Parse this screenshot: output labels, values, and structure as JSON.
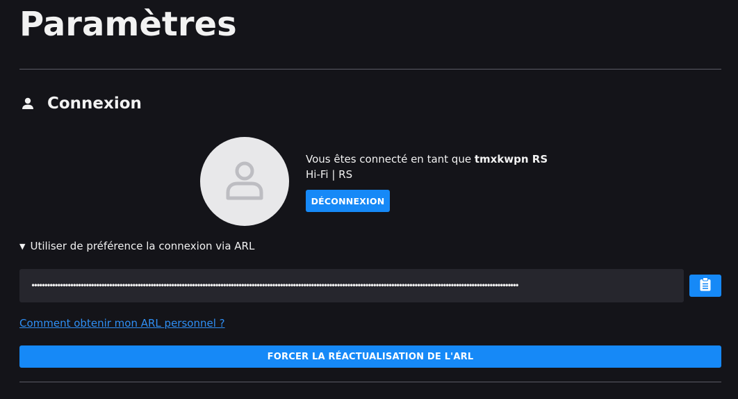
{
  "page": {
    "title": "Paramètres"
  },
  "connexion": {
    "section_title": "Connexion",
    "section_icon": "user-icon",
    "avatar_icon": "user-avatar-icon",
    "logged_in_prefix": "Vous êtes connecté en tant que",
    "username": "tmxkwpn RS",
    "plan": "Hi-Fi | RS",
    "logout_label": "DÉCONNEXION"
  },
  "arl": {
    "toggle_caret": "▼",
    "toggle_label": "Utiliser de préférence la connexion via ARL",
    "masked_value": "••••••••••••••••••••••••••••••••••••••••••••••••••••••••••••••••••••••••••••••••••••••••••••••••••••••••••••••••••••••••••••••••••••••••••••••••••••••••••••••••••••••••••••••••••••••••••••",
    "clipboard_icon": "clipboard-icon",
    "help_link": "Comment obtenir mon ARL personnel ?",
    "refresh_label": "FORCER LA RÉACTUALISATION DE L'ARL"
  },
  "colors": {
    "background": "#141419",
    "accent": "#1689f7",
    "link": "#2f8ff5",
    "input_background": "#26262d",
    "avatar_background": "#e8e8ea"
  }
}
